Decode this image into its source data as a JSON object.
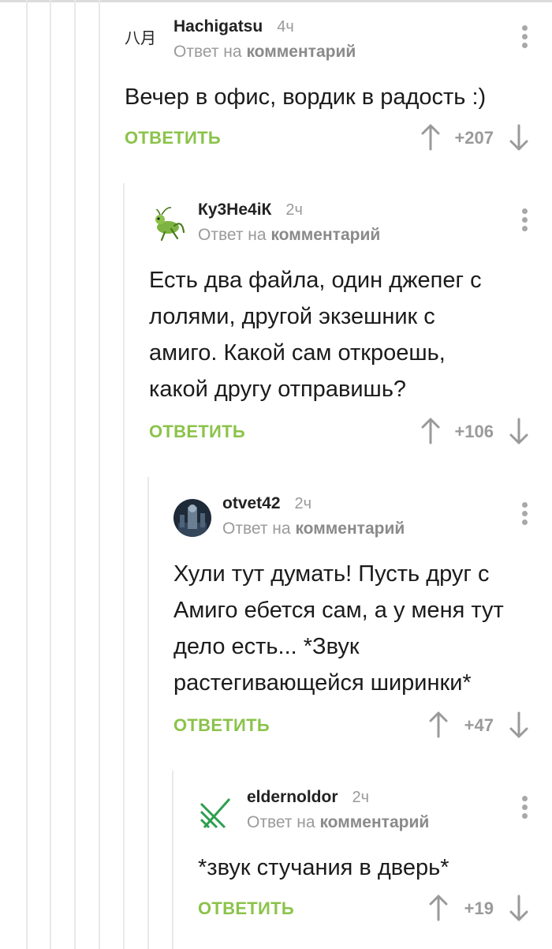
{
  "labels": {
    "reply_on": "Ответ на",
    "comment": "комментарий",
    "reply_action": "ОТВЕТИТЬ"
  },
  "comments": [
    {
      "author": "Hachigatsu",
      "time": "4ч",
      "avatar_text": "八月",
      "text": "Вечер в офис, вордик в радость :)",
      "score": "+207"
    },
    {
      "author": "Ку3Не4іК",
      "time": "2ч",
      "avatar_icon": "grasshopper-icon",
      "text": "Есть два файла, один джепег с лолями, другой экзешник с амиго. Какой сам откроешь, какой другу отправишь?",
      "score": "+106"
    },
    {
      "author": "otvet42",
      "time": "2ч",
      "avatar_icon": "avatar-photo",
      "text": "Хули тут думать! Пусть друг с Амиго ебется сам, а у меня тут дело есть... *Звук растегивающейся ширинки*",
      "score": "+47"
    },
    {
      "author": "eldernoldor",
      "time": "2ч",
      "avatar_icon": "green-stripes-logo",
      "text": "*звук стучания в дверь*",
      "score": "+19"
    }
  ],
  "colors": {
    "accent": "#8bc34a",
    "muted": "#9a9a9a",
    "thread_line": "#e9e9e9"
  }
}
